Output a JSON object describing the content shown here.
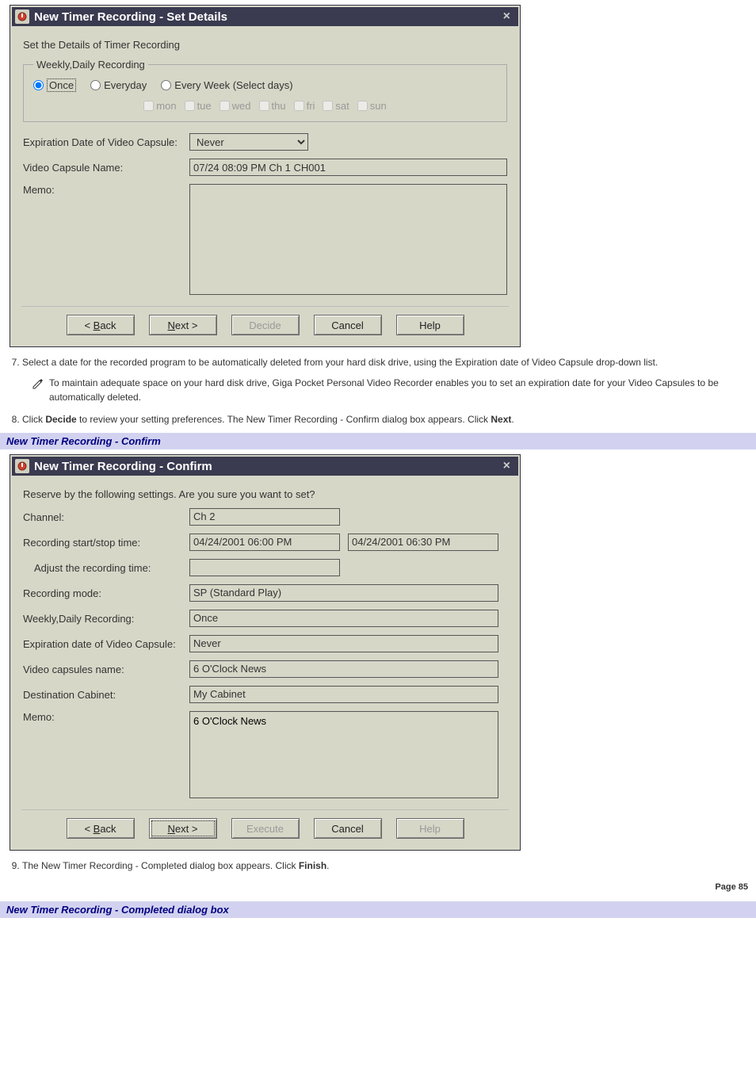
{
  "dialog1": {
    "title": "New Timer Recording - Set Details",
    "prompt": "Set the Details of Timer Recording",
    "group_legend": "Weekly,Daily Recording",
    "radios": {
      "once": "Once",
      "everyday": "Everyday",
      "selectdays": "Every Week (Select days)"
    },
    "days": {
      "mon": "mon",
      "tue": "tue",
      "wed": "wed",
      "thu": "thu",
      "fri": "fri",
      "sat": "sat",
      "sun": "sun"
    },
    "labels": {
      "expiration": "Expiration Date of Video Capsule:",
      "capsule_name": "Video Capsule Name:",
      "memo": "Memo:"
    },
    "values": {
      "expiration": "Never",
      "capsule_name": "07/24 08:09 PM Ch 1 CH001",
      "memo": ""
    },
    "buttons": {
      "back_pre": "< ",
      "back_u": "B",
      "back_post": "ack",
      "next_u": "N",
      "next_post": "ext >",
      "decide": "Decide",
      "cancel": "Cancel",
      "help": "Help"
    }
  },
  "step7": {
    "num": "7.",
    "text": "Select a date for the recorded program to be automatically deleted from your hard disk drive, using the Expiration date of Video Capsule drop-down list."
  },
  "note7": "To maintain adequate space on your hard disk drive, Giga Pocket Personal Video Recorder enables you to set an expiration date for your Video Capsules to be automatically deleted.",
  "step8": {
    "num": "8.",
    "pre": "Click ",
    "b1": "Decide",
    "mid": " to review your setting preferences. The New Timer Recording - Confirm dialog box appears. Click ",
    "b2": "Next",
    "post": "."
  },
  "section2_head": "New Timer Recording - Confirm",
  "dialog2": {
    "title": "New Timer Recording - Confirm",
    "prompt": "Reserve by the following settings. Are you sure you want to set?",
    "labels": {
      "channel": "Channel:",
      "startstop": "Recording start/stop time:",
      "adjust": "Adjust the recording time:",
      "mode": "Recording mode:",
      "weekly": "Weekly,Daily Recording:",
      "expiration": "Expiration date of Video Capsule:",
      "capsules": "Video capsules name:",
      "dest": "Destination Cabinet:",
      "memo": "Memo:"
    },
    "values": {
      "channel": "Ch 2",
      "start": "04/24/2001 06:00 PM",
      "stop": "04/24/2001 06:30 PM",
      "adjust": "",
      "mode": "SP (Standard Play)",
      "weekly": "Once",
      "expiration": "Never",
      "capsules": "6 O'Clock News",
      "dest": "My Cabinet",
      "memo": "6 O'Clock News"
    },
    "buttons": {
      "back_pre": "< ",
      "back_u": "B",
      "back_post": "ack",
      "next_u": "N",
      "next_post": "ext >",
      "execute": "Execute",
      "cancel": "Cancel",
      "help": "Help"
    }
  },
  "step9": {
    "num": "9.",
    "pre": "The New Timer Recording - Completed dialog box appears. Click ",
    "b": "Finish",
    "post": "."
  },
  "page_num": "Page 85",
  "section3_head": "New Timer Recording - Completed dialog box"
}
